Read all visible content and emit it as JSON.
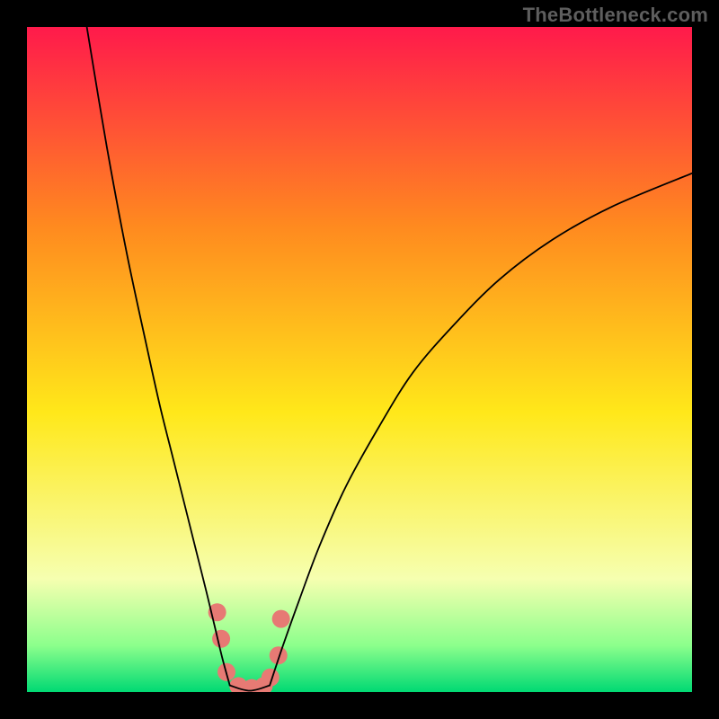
{
  "watermark": "TheBottleneck.com",
  "chart_data": {
    "type": "line",
    "title": "",
    "xlabel": "",
    "ylabel": "",
    "xlim": [
      0,
      100
    ],
    "ylim": [
      0,
      100
    ],
    "background_gradient": {
      "top": "#ff1a4b",
      "upper_mid": "#ff8a1f",
      "mid": "#ffe81a",
      "lower_mid": "#f6ffb0",
      "bottom_band_top": "#8cff8c",
      "bottom": "#00d973"
    },
    "series": [
      {
        "name": "left-curve",
        "color": "#000000",
        "stroke_width": 1.8,
        "x": [
          9.0,
          12.0,
          15.0,
          18.0,
          20.0,
          22.0,
          24.0,
          25.5,
          27.0,
          28.2,
          29.4,
          30.5
        ],
        "y": [
          100.0,
          82.0,
          66.0,
          52.0,
          43.0,
          35.0,
          27.0,
          21.0,
          15.0,
          10.0,
          5.0,
          1.0
        ]
      },
      {
        "name": "right-curve",
        "color": "#000000",
        "stroke_width": 1.8,
        "x": [
          36.5,
          38.5,
          41.0,
          44.0,
          48.0,
          53.0,
          58.0,
          64.0,
          71.0,
          79.0,
          88.0,
          100.0
        ],
        "y": [
          1.0,
          7.0,
          14.0,
          22.0,
          31.0,
          40.0,
          48.0,
          55.0,
          62.0,
          68.0,
          73.0,
          78.0
        ]
      },
      {
        "name": "bottom-flat",
        "color": "#000000",
        "stroke_width": 1.8,
        "x": [
          30.5,
          33.5,
          36.5
        ],
        "y": [
          1.0,
          0.2,
          1.0
        ]
      }
    ],
    "dot_cluster": {
      "name": "highlight-dots",
      "color": "#e77a74",
      "radius": 10,
      "points": [
        {
          "x": 28.6,
          "y": 12.0
        },
        {
          "x": 29.2,
          "y": 8.0
        },
        {
          "x": 30.0,
          "y": 3.0
        },
        {
          "x": 31.8,
          "y": 0.9
        },
        {
          "x": 33.8,
          "y": 0.6
        },
        {
          "x": 35.6,
          "y": 0.9
        },
        {
          "x": 36.6,
          "y": 2.2
        },
        {
          "x": 37.8,
          "y": 5.5
        },
        {
          "x": 38.2,
          "y": 11.0
        }
      ]
    }
  }
}
